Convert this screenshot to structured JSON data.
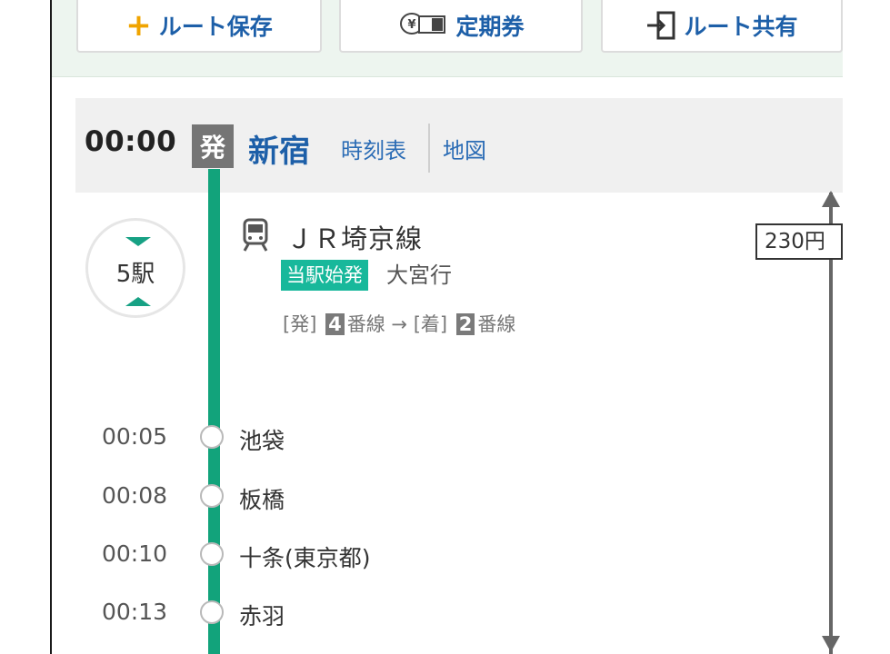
{
  "toolbar": {
    "save_label": "ルート保存",
    "pass_label": "定期券",
    "share_label": "ルート共有"
  },
  "departure": {
    "time": "00:00",
    "badge": "発",
    "station": "新宿",
    "timetable_link": "時刻表",
    "map_link": "地図"
  },
  "segment": {
    "stop_count": "5駅",
    "line_name": "ＪＲ埼京線",
    "origin_badge": "当駅始発",
    "destination": "大宮行",
    "platform": {
      "dep_label": "[発]",
      "dep_num": "4",
      "dep_suffix": "番線",
      "arrow": "→",
      "arr_label": "[着]",
      "arr_num": "2",
      "arr_suffix": "番線"
    },
    "fare": "230円"
  },
  "stops": [
    {
      "time": "00:05",
      "name": "池袋"
    },
    {
      "time": "00:08",
      "name": "板橋"
    },
    {
      "time": "00:10",
      "name": "十条(東京都)"
    },
    {
      "time": "00:13",
      "name": "赤羽"
    }
  ],
  "colors": {
    "line": "#12a37b",
    "link": "#1d5fa8",
    "accent": "#f0a400"
  }
}
